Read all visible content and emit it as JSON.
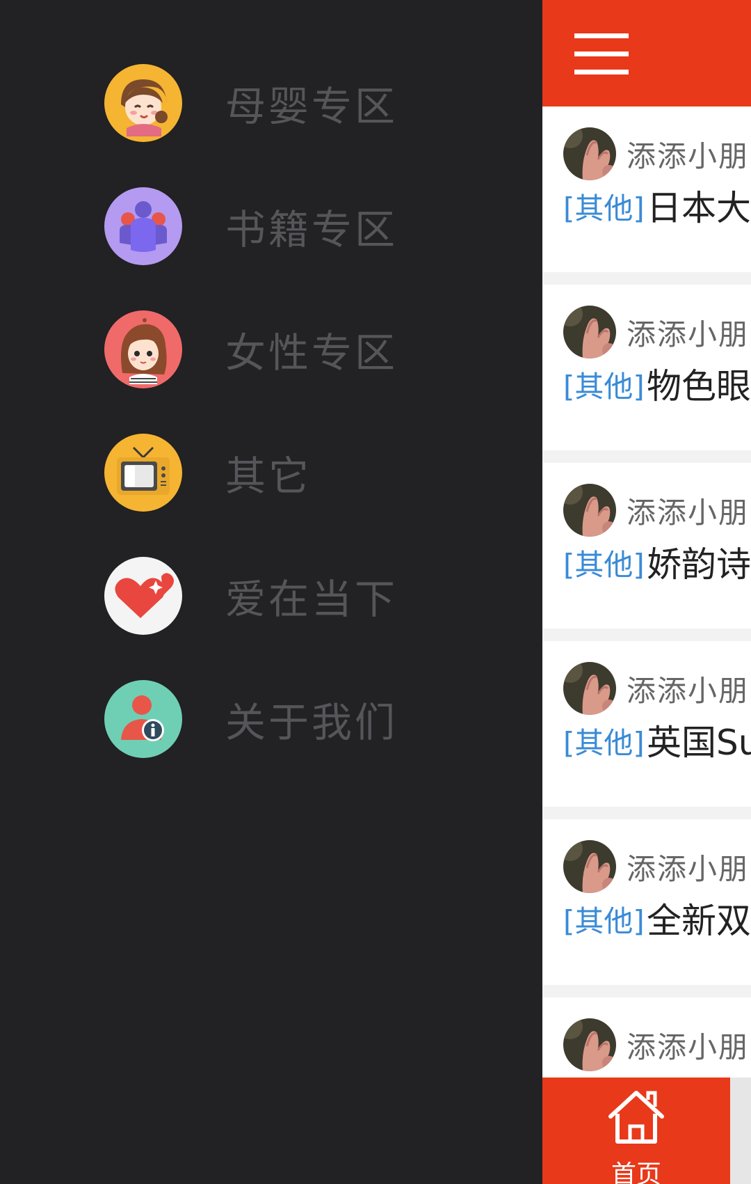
{
  "drawer": {
    "items": [
      {
        "label": "母婴专区",
        "icon": "baby-mother-icon"
      },
      {
        "label": "书籍专区",
        "icon": "books-group-icon"
      },
      {
        "label": "女性专区",
        "icon": "woman-icon"
      },
      {
        "label": "其它",
        "icon": "tv-icon"
      },
      {
        "label": "爱在当下",
        "icon": "heart-icon"
      },
      {
        "label": "关于我们",
        "icon": "about-info-icon"
      }
    ]
  },
  "header": {
    "menu_icon": "menu-icon"
  },
  "feed": {
    "posts": [
      {
        "author": "添添小朋",
        "tag": "[其他]",
        "title": "日本大"
      },
      {
        "author": "添添小朋",
        "tag": "[其他]",
        "title": "物色眼"
      },
      {
        "author": "添添小朋",
        "tag": "[其他]",
        "title": "娇韵诗"
      },
      {
        "author": "添添小朋",
        "tag": "[其他]",
        "title": "英国Su"
      },
      {
        "author": "添添小朋",
        "tag": "[其他]",
        "title": "全新双"
      },
      {
        "author": "添添小朋",
        "tag": "",
        "title": ""
      }
    ]
  },
  "tabbar": {
    "home_label": "首页"
  },
  "colors": {
    "accent": "#e8391a",
    "drawer_bg": "#222123",
    "tag_blue": "#3a8bd6"
  }
}
